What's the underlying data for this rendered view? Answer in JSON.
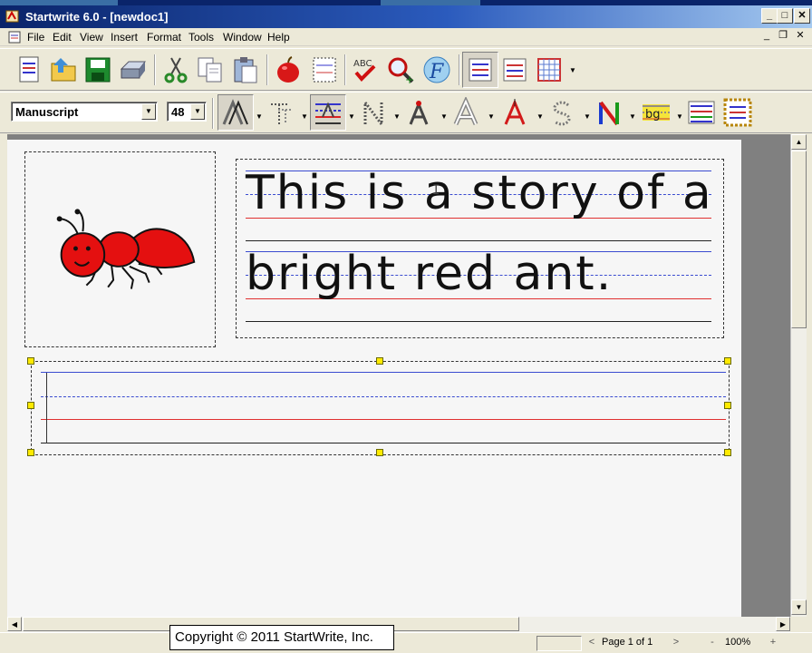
{
  "window": {
    "title": "Startwrite 6.0 - [newdoc1]",
    "minimize_glyph": "_",
    "maximize_glyph": "□",
    "close_glyph": "✕",
    "mdi_minimize_glyph": "_",
    "mdi_restore_glyph": "❐",
    "mdi_close_glyph": "✕"
  },
  "menu": [
    "File",
    "Edit",
    "View",
    "Insert",
    "Format",
    "Tools",
    "Window",
    "Help"
  ],
  "toolbar1": {
    "buttons": [
      "new-document",
      "open-folder",
      "save",
      "print",
      "cut",
      "copy",
      "paste",
      "apple-clipart",
      "page-frame",
      "spell-check",
      "zoom-add",
      "font-f",
      "lines-blue",
      "lines-red",
      "grid"
    ]
  },
  "toolbar2": {
    "font_name": "Manuscript",
    "font_size": "48",
    "buttons": [
      "outline-a",
      "dotted-t",
      "guide-lines",
      "dotted-n",
      "start-dot-a",
      "outline-a2",
      "red-a",
      "dotted-s",
      "color-n",
      "bg-highlight",
      "decision-dots",
      "border-box"
    ]
  },
  "document": {
    "handwriting_lines": [
      "This is a story of a",
      "bright red ant."
    ],
    "colors": {
      "top_line": "#3a4bd0",
      "mid_line": "#3a4bd0",
      "base_line": "#e03030",
      "desc_line": "#222222",
      "ant_red": "#e41010"
    }
  },
  "status": {
    "page_label": "Page 1 of 1",
    "zoom": "100%",
    "zoom_minus": "-",
    "zoom_plus": "+",
    "prev_glyph": "<",
    "next_glyph": ">"
  },
  "copyright": "Copyright © 2011 StartWrite, Inc."
}
